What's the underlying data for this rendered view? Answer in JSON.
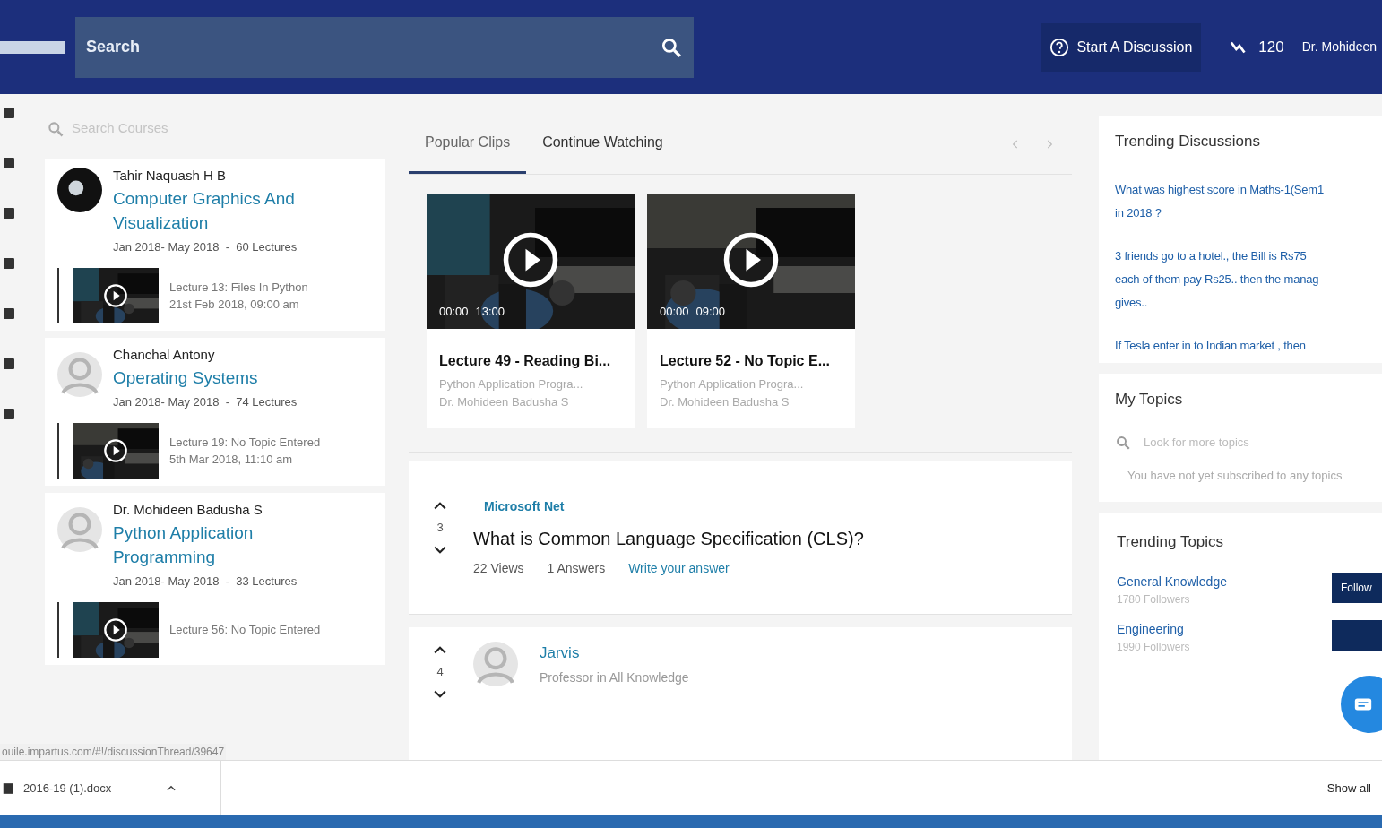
{
  "header": {
    "search_placeholder": "Search",
    "start_discussion": "Start A Discussion",
    "points": "120",
    "user": "Dr. Mohideen"
  },
  "courses_panel": {
    "search_placeholder": "Search Courses",
    "courses": [
      {
        "instructor": "Tahir Naquash H B",
        "title": "Computer Graphics And Visualization",
        "meta": "Jan 2018- May 2018  -  60 Lectures",
        "lecture": {
          "title": "Lecture 13: Files In Python",
          "date": "21st Feb 2018, 09:00 am"
        }
      },
      {
        "instructor": "Chanchal Antony",
        "kind": "default",
        "title": "Operating Systems",
        "meta": "Jan 2018- May 2018  -  74 Lectures",
        "lecture": {
          "title": "Lecture 19: No Topic Entered",
          "date": "5th Mar 2018, 11:10 am"
        }
      },
      {
        "instructor": "Dr. Mohideen Badusha S",
        "kind": "default",
        "title": "Python Application Programming",
        "meta": "Jan 2018- May 2018  -  33 Lectures",
        "lecture": {
          "title": "Lecture 56: No Topic Entered"
        }
      }
    ]
  },
  "clips_panel": {
    "tabs": [
      {
        "label": "Popular Clips",
        "selected": true
      },
      {
        "label": "Continue Watching",
        "selected": false
      }
    ],
    "clips": [
      {
        "time_start": "00:00",
        "time_end": "13:00",
        "title": "Lecture 49 - Reading Bi...",
        "course": "Python Application Progra...",
        "instructor": "Dr. Mohideen Badusha S"
      },
      {
        "time_start": "00:00",
        "time_end": "09:00",
        "title": "Lecture 52 - No Topic E...",
        "course": "Python Application Progra...",
        "instructor": "Dr. Mohideen Badusha S"
      }
    ]
  },
  "feed": {
    "question": {
      "votes": "3",
      "tag": "Microsoft Net",
      "title": "What is Common Language Specification (CLS)?",
      "views": "22 Views",
      "answers": "1 Answers",
      "link": "Write your answer"
    },
    "answer": {
      "votes": "4",
      "name": "Jarvis",
      "role": "Professor in All Knowledge"
    }
  },
  "status_url": "ouile.impartus.com/#!/discussionThread/39647",
  "sidebar": {
    "trending_discussions": {
      "title": "Trending Discussions",
      "items": [
        "What was highest score in Maths-1(Sem1",
        "in 2018 ?",
        "3 friends go to a hotel., the Bill is Rs75",
        "each of them pay Rs25.. then the manag",
        "gives..",
        "If Tesla enter in to Indian market , then"
      ]
    },
    "my_topics": {
      "title": "My Topics",
      "search_placeholder": "Look for more topics",
      "empty_message": "You have not yet subscribed to any topics"
    },
    "trending_topics": {
      "title": "Trending Topics",
      "items": [
        {
          "name": "General Knowledge",
          "followers": "1780 Followers",
          "button": "Follow"
        },
        {
          "name": "Engineering",
          "followers": "1990 Followers"
        }
      ]
    }
  },
  "downloads": {
    "file": "2016-19 (1).docx",
    "show_all": "Show all"
  }
}
